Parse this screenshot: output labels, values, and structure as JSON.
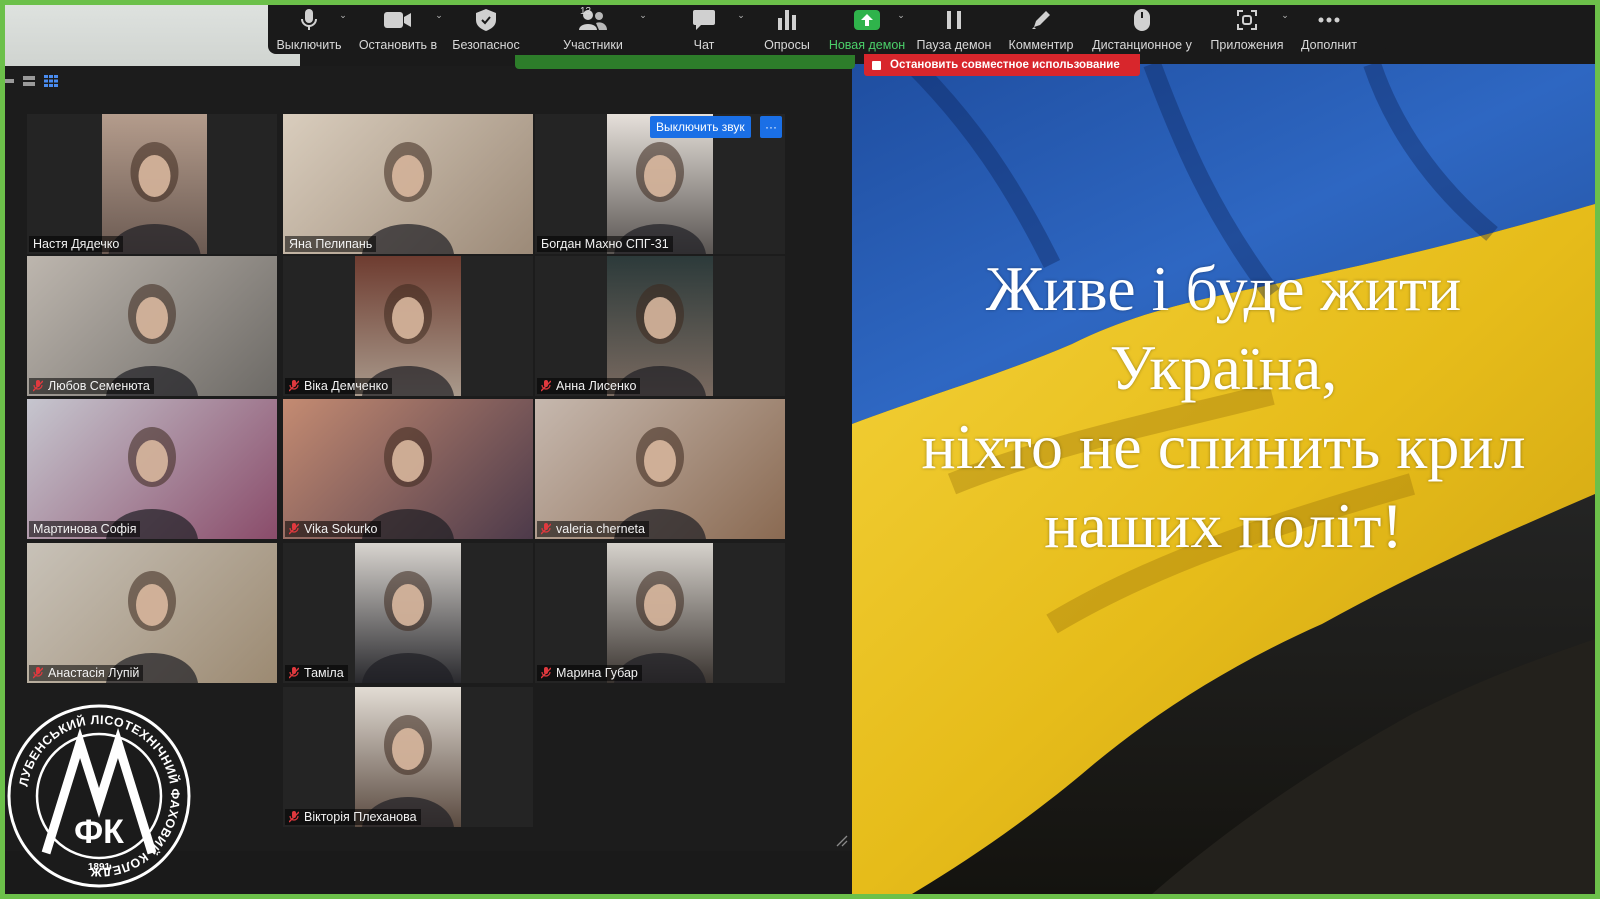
{
  "toolbar": {
    "items": [
      {
        "label": "Выключить",
        "icon": "microphone-icon"
      },
      {
        "label": "Остановить в",
        "icon": "video-camera-icon"
      },
      {
        "label": "Безопаснос",
        "icon": "shield-icon"
      },
      {
        "label": "Участники",
        "icon": "participants-icon",
        "count": "13"
      },
      {
        "label": "Чат",
        "icon": "chat-icon"
      },
      {
        "label": "Опросы",
        "icon": "polls-icon"
      },
      {
        "label": "Новая демон",
        "icon": "share-screen-icon"
      },
      {
        "label": "Пауза демон",
        "icon": "pause-icon"
      },
      {
        "label": "Комментир",
        "icon": "annotate-pencil-icon"
      },
      {
        "label": "Дистанционное у",
        "icon": "remote-control-mouse-icon"
      },
      {
        "label": "Приложения",
        "icon": "apps-icon"
      },
      {
        "label": "Дополнит",
        "icon": "more-dots-icon"
      }
    ]
  },
  "share": {
    "stop_label": "Остановить совместное использование"
  },
  "gallery": {
    "mute_button": "Выключить звук",
    "more_button": "···",
    "participants": [
      {
        "name": "Настя Дядечко",
        "muted": false
      },
      {
        "name": "Яна Пелипань",
        "muted": false
      },
      {
        "name": "Богдан Махно СПГ-31",
        "muted": false
      },
      {
        "name": "Любов Семенюта",
        "muted": true
      },
      {
        "name": "Віка Демченко",
        "muted": true
      },
      {
        "name": "Анна Лисенко",
        "muted": true
      },
      {
        "name": "Мартинова Софія",
        "muted": false
      },
      {
        "name": "Vika Sokurko",
        "muted": true
      },
      {
        "name": "valeria cherneta",
        "muted": true
      },
      {
        "name": "Анастасія Лупій",
        "muted": true
      },
      {
        "name": "Таміла",
        "muted": true
      },
      {
        "name": "Марина Губар",
        "muted": true
      },
      {
        "name": "Вікторія Плеханова",
        "muted": true
      }
    ]
  },
  "slide": {
    "lines": [
      "Живе і буде жити",
      "Україна,",
      "ніхто не спинить крил",
      "наших політ!"
    ]
  },
  "logo": {
    "ring_text": "ЛУБЕНСЬКИЙ ЛІСОТЕХНІЧНИЙ ФАХОВИЙ КОЛЕДЖ",
    "letters": "ФК",
    "year": "1891"
  },
  "colors": {
    "share_border": "#6cc04a",
    "flag_blue": "#2a5fb4",
    "flag_yellow": "#f1cd2a",
    "stop_red": "#d8262c",
    "zoom_blue": "#1a6fe6",
    "mute_red": "#e0393e"
  }
}
